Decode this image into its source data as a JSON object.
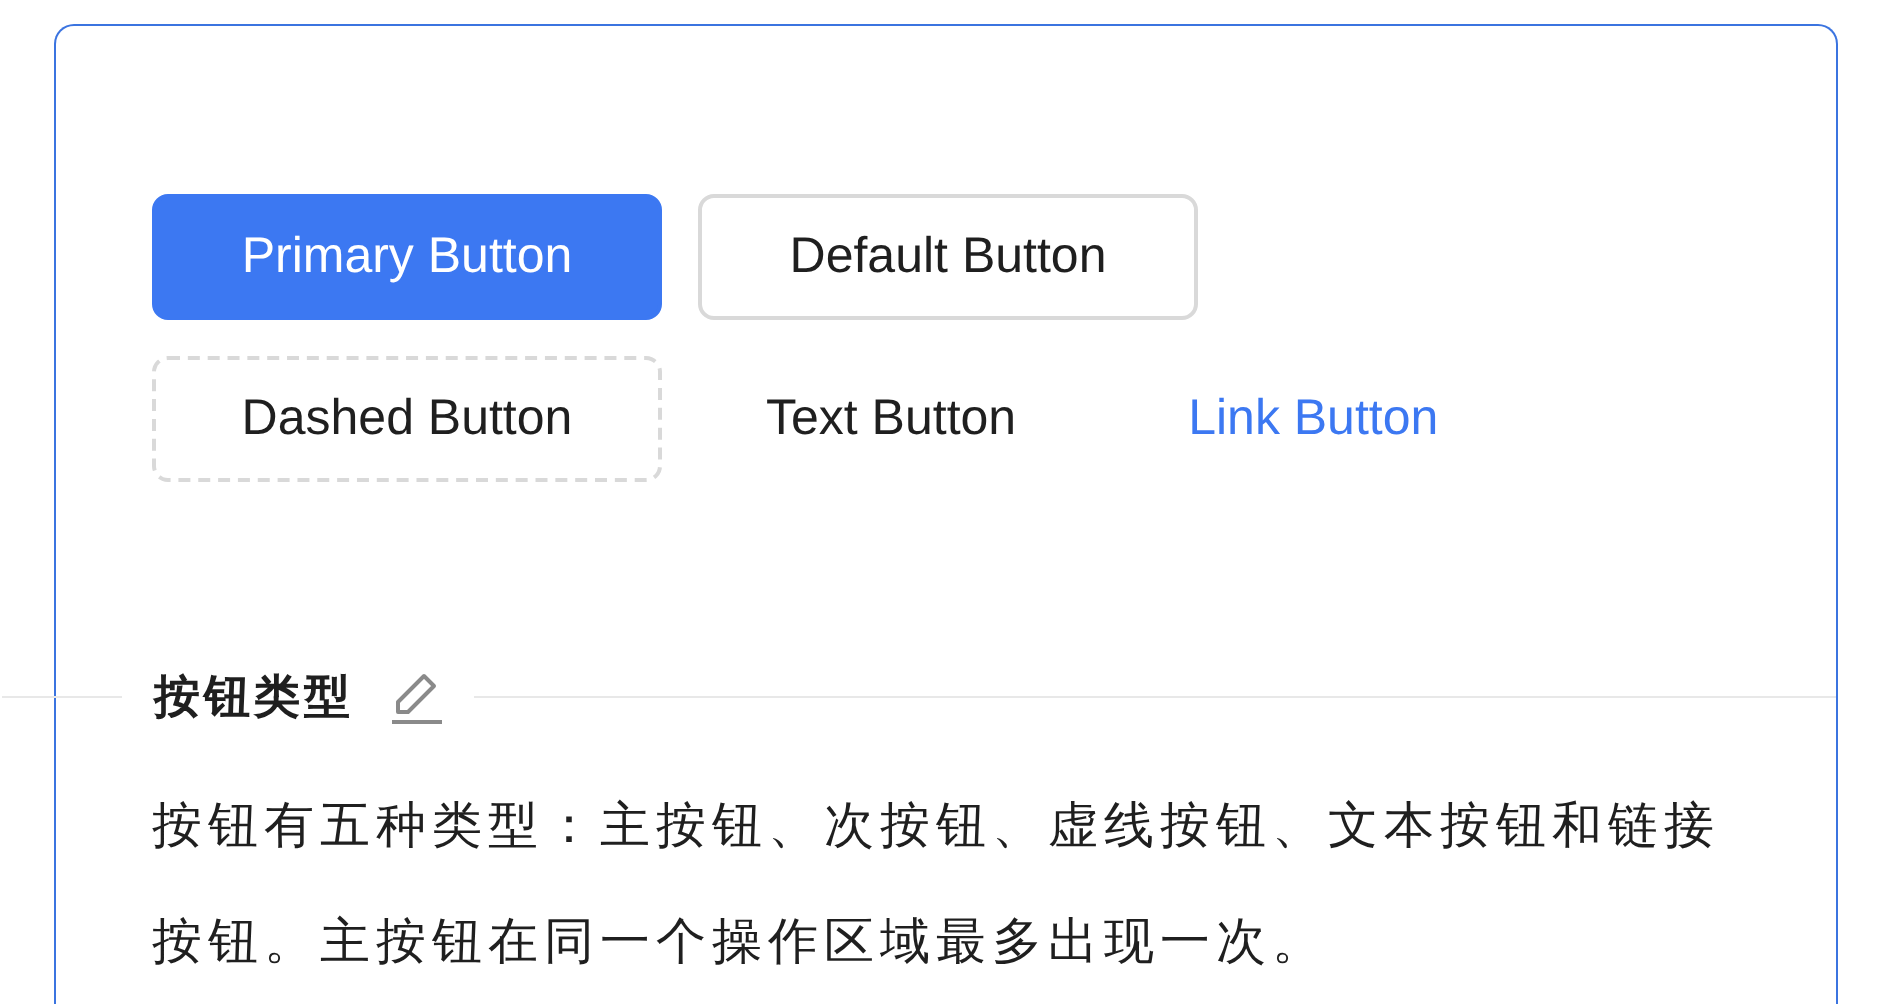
{
  "buttons": [
    {
      "label": "Primary Button",
      "kind": "primary"
    },
    {
      "label": "Default Button",
      "kind": "default"
    },
    {
      "label": "Dashed Button",
      "kind": "dashed"
    },
    {
      "label": "Text Button",
      "kind": "text"
    },
    {
      "label": "Link Button",
      "kind": "link"
    }
  ],
  "section": {
    "title": "按钮类型",
    "description": "按钮有五种类型：主按钮、次按钮、虚线按钮、文本按钮和链接按钮。主按钮在同一个操作区域最多出现一次。"
  }
}
